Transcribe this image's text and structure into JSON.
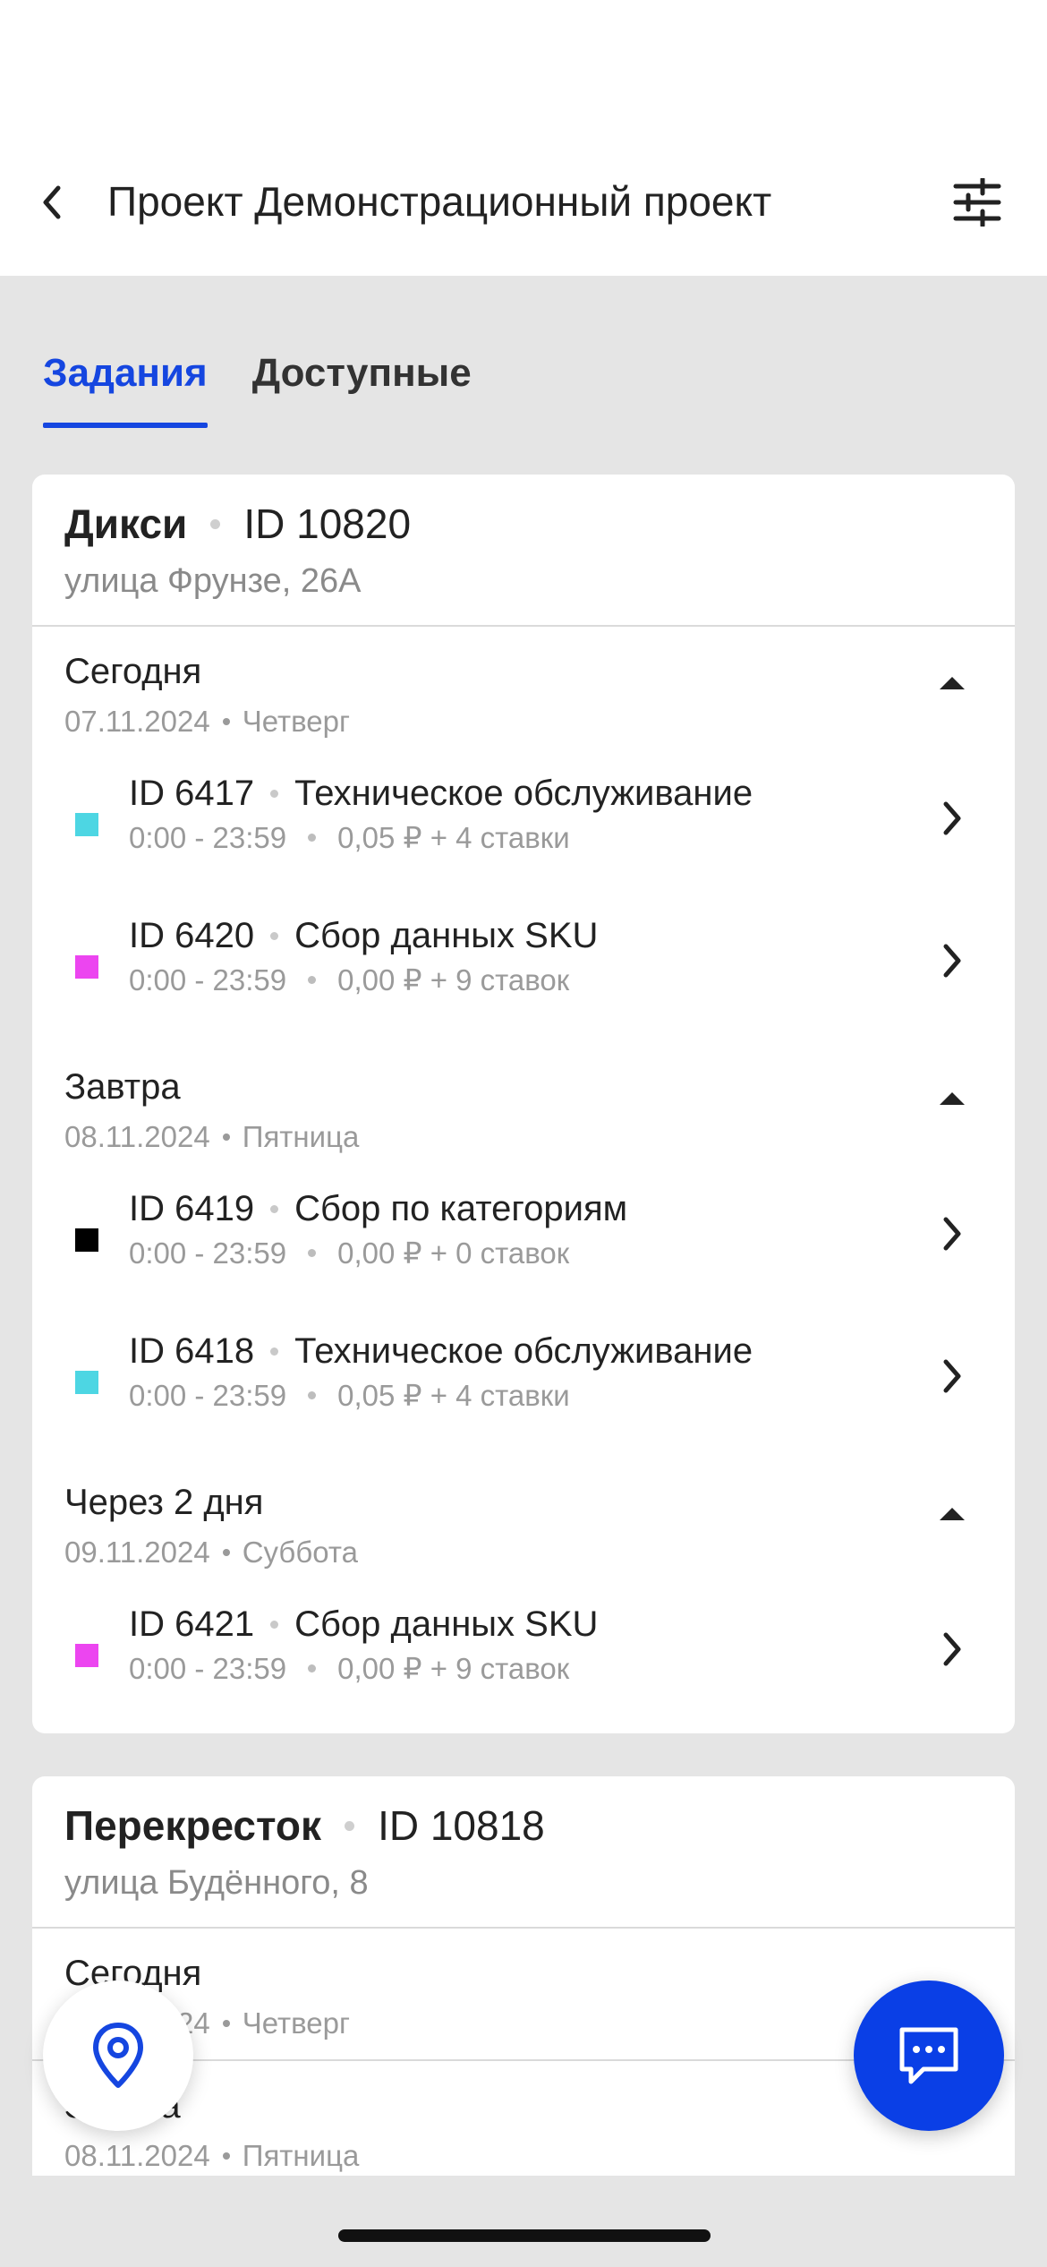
{
  "header": {
    "title": "Проект Демонстрационный проект"
  },
  "tabs": [
    {
      "label": "Задания",
      "active": true
    },
    {
      "label": "Доступные",
      "active": false
    }
  ],
  "stores": [
    {
      "name": "Дикси",
      "id": "ID 10820",
      "address": "улица Фрунзе, 26А",
      "days": [
        {
          "title": "Сегодня",
          "date": "07.11.2024",
          "weekday": "Четверг",
          "tasks": [
            {
              "id": "ID 6417",
              "name": "Техническое обслуживание",
              "time": "0:00 - 23:59",
              "reward": "0,05 ₽ + 4 ставки",
              "color": "#4dd6e3"
            },
            {
              "id": "ID 6420",
              "name": "Сбор данных SKU",
              "time": "0:00 - 23:59",
              "reward": "0,00 ₽ + 9 ставок",
              "color": "#ec45f0"
            }
          ]
        },
        {
          "title": "Завтра",
          "date": "08.11.2024",
          "weekday": "Пятница",
          "tasks": [
            {
              "id": "ID 6419",
              "name": "Сбор по категориям",
              "time": "0:00 - 23:59",
              "reward": "0,00 ₽ + 0 ставок",
              "color": "#000000"
            },
            {
              "id": "ID 6418",
              "name": "Техническое обслуживание",
              "time": "0:00 - 23:59",
              "reward": "0,05 ₽ + 4 ставки",
              "color": "#4dd6e3"
            }
          ]
        },
        {
          "title": "Через 2 дня",
          "date": "09.11.2024",
          "weekday": "Суббота",
          "tasks": [
            {
              "id": "ID 6421",
              "name": "Сбор данных SKU",
              "time": "0:00 - 23:59",
              "reward": "0,00 ₽ + 9 ставок",
              "color": "#ec45f0"
            }
          ]
        }
      ]
    },
    {
      "name": "Перекресток",
      "id": "ID 10818",
      "address": "улица Будённого, 8",
      "days": [
        {
          "title": "Сегодня",
          "date": "07.11.2024",
          "weekday": "Четверг"
        },
        {
          "title": "Завтра",
          "date": "08.11.2024",
          "weekday": "Пятница"
        }
      ]
    }
  ],
  "colors": {
    "accent": "#1546e0",
    "chat_button": "#0a3fe6"
  },
  "icons": {
    "back": "chevron-left-icon",
    "filter": "sliders-icon",
    "map": "map-pin-icon",
    "chat": "chat-bubble-icon",
    "expand": "caret-up-icon",
    "task_open": "chevron-right-icon"
  }
}
